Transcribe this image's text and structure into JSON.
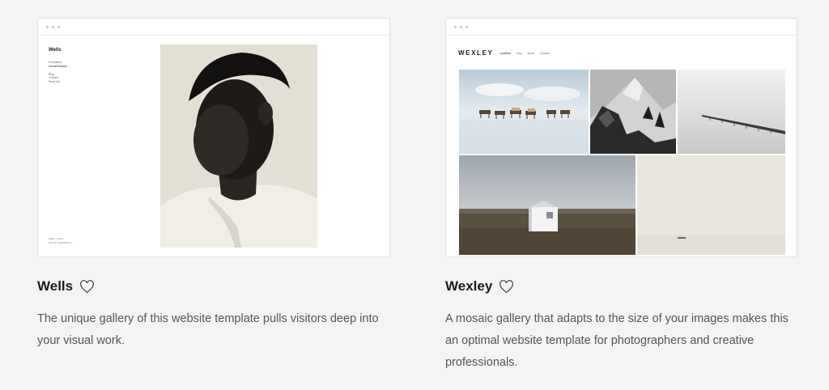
{
  "templates": [
    {
      "title": "Wells",
      "description": "The unique gallery of this website template pulls visitors deep into your visual work.",
      "preview": {
        "logo": "Wells",
        "nav_primary": [
          "Portraiture",
          "Human/Nature"
        ],
        "nav_secondary": [
          "Blog",
          "Contact",
          "Read Me"
        ],
        "footer": [
          "PREV / NEXT",
          "SHOW THUMBNAILS"
        ]
      }
    },
    {
      "title": "Wexley",
      "description": "A mosaic gallery that adapts to the size of your images makes this an optimal website template for photographers and creative professionals.",
      "preview": {
        "logo": "WEXLEY",
        "nav": [
          "portfolio",
          "blog",
          "about",
          "contact"
        ]
      }
    }
  ],
  "icons": {
    "favorite": "heart-outline-icon",
    "window_controls": "dot-icon"
  },
  "colors": {
    "background": "#f5f4f4",
    "text": "#1a1a1a",
    "muted": "#555555"
  }
}
